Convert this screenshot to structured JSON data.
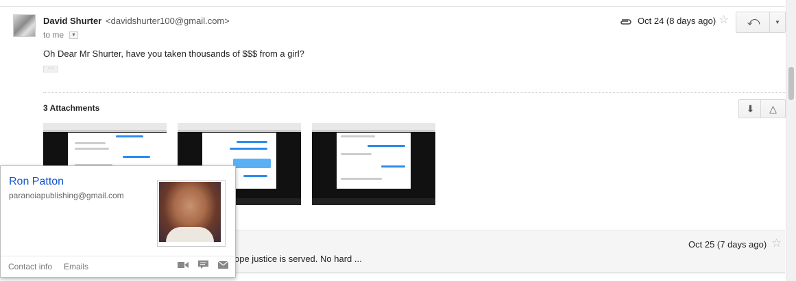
{
  "message": {
    "sender_name": "David Shurter",
    "sender_email": "<davidshurter100@gmail.com>",
    "to_label": "to me",
    "date": "Oct 24 (8 days ago)",
    "body": "Oh Dear Mr Shurter, have you taken thousands of $$$ from a girl?",
    "ellipsis": "···"
  },
  "attachments": {
    "title": "3 Attachments"
  },
  "next_message": {
    "snippet": "ope justice is served. No hard ...",
    "date": "Oct 25 (7 days ago)"
  },
  "contact_card": {
    "name": "Ron Patton",
    "email": "paranoiapublishing@gmail.com",
    "links": [
      "Contact info",
      "Emails"
    ]
  },
  "icons": {
    "attachment": "paperclip-icon",
    "star": "star-icon",
    "reply": "reply-icon",
    "more": "dropdown-icon",
    "download": "download-icon",
    "drive": "drive-icon",
    "video": "video-icon",
    "chat": "chat-icon",
    "mail": "mail-icon"
  },
  "colors": {
    "link": "#1155cc",
    "bubble": "#2a8bf2"
  }
}
